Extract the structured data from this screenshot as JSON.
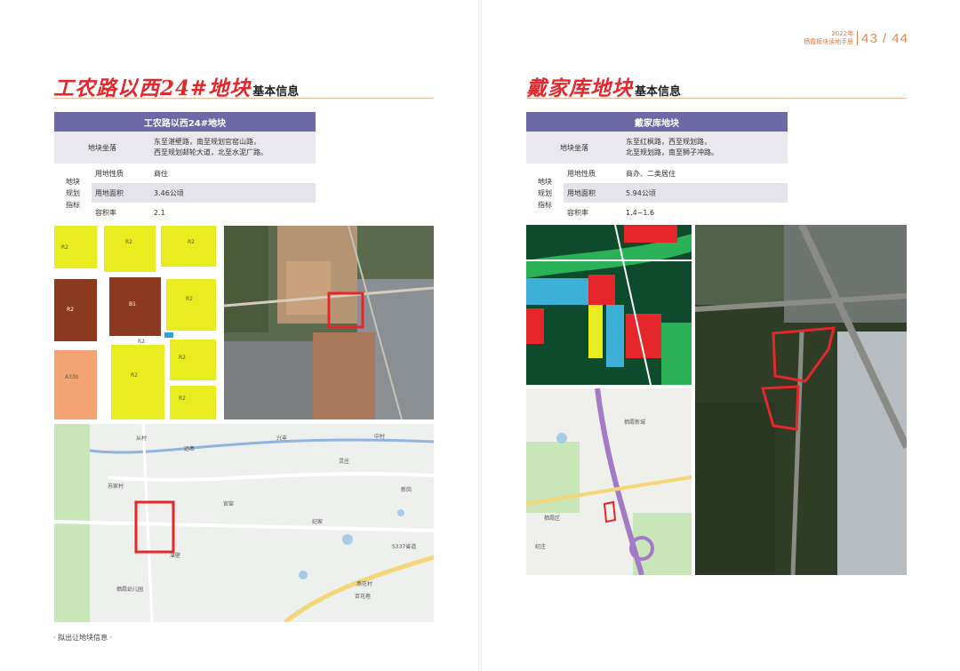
{
  "header": {
    "year_label": "2022年",
    "guide_label": "栖霞板块读地手册",
    "pages": "43 / 44"
  },
  "left": {
    "title_hand": "工农路以西24#地块",
    "title_tail": "基本信息",
    "table": {
      "heading": "工农路以西24#地块",
      "location_label": "地块坐落",
      "location_lines": [
        "东至湛壁路，南至规划官窑山路，",
        "西至规划邮轮大道，北至水泥厂路。"
      ],
      "group_label_lines": [
        "地块",
        "规划",
        "指标"
      ],
      "rows": [
        {
          "label": "用地性质",
          "value": "商住"
        },
        {
          "label": "用地面积",
          "value": "3.46公顷"
        },
        {
          "label": "容积率",
          "value": "2.1"
        }
      ]
    }
  },
  "right": {
    "title_hand": "戴家库地块",
    "title_tail": "基本信息",
    "table": {
      "heading": "戴家库地块",
      "location_label": "地块坐落",
      "location_lines": [
        "东至红枫路，西至规划路，",
        "北至规划路，南至狮子冲路。"
      ],
      "group_label_lines": [
        "地块",
        "规划",
        "指标"
      ],
      "rows": [
        {
          "label": "用地性质",
          "value": "商办、二类居住"
        },
        {
          "label": "用地面积",
          "value": "5.94公顷"
        },
        {
          "label": "容积率",
          "value": "1.4~1.6"
        }
      ]
    }
  },
  "maps": {
    "zoning_labels": [
      "R2",
      "R2",
      "R2",
      "R2",
      "B1",
      "R2",
      "R2",
      "R2",
      "A33b",
      "R2",
      "R2"
    ],
    "street_labels": [
      "从村",
      "迈皋",
      "兴丰",
      "中村",
      "灵庄",
      "新岗",
      "官窑",
      "苏家村",
      "纪家",
      "湛壁",
      "栖霞幼儿园",
      "燕花村",
      "百花巷",
      "S337省道",
      "栖霞区",
      "纪庄",
      "栖霞新城"
    ]
  },
  "footer": {
    "note": "· 拟出让地块信息 ·"
  },
  "colors": {
    "accent_red": "#e5262a",
    "table_header": "#6d69a6",
    "header_orange": "#e0793a"
  }
}
